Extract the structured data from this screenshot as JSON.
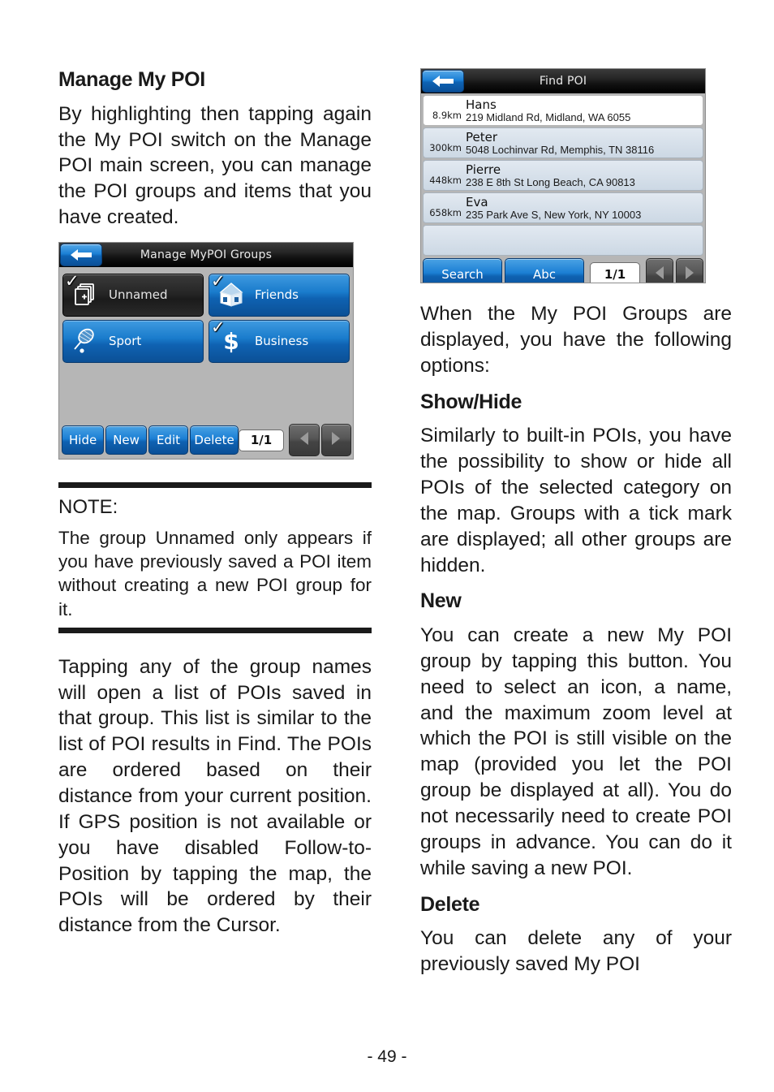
{
  "page": {
    "folio": "- 49 -"
  },
  "left": {
    "heading": "Manage My POI",
    "intro": "By highlighting then tapping again the My POI switch on the Manage POI main screen, you can manage the POI groups and items that you have created.",
    "note": {
      "label": "NOTE:",
      "text": "The group Unnamed only appears if you have previously saved a POI item without creating a new POI group for it."
    },
    "after_note": "Tapping any of the group names will open a list of POIs saved in that group. This list is similar to the list of POI results in Find. The POIs are ordered based on their distance from your current position. If GPS position is not available or you have disabled Follow-to-Position by tapping the map, the POIs will be ordered by their distance from the Cursor."
  },
  "right": {
    "intro": "When the My POI Groups are displayed, you have the following options:",
    "sections": [
      {
        "heading": "Show/Hide",
        "text": "Similarly to built-in POIs, you have the possibility to show or hide all POIs of the selected category on the map. Groups with a tick mark are displayed; all other groups are hidden."
      },
      {
        "heading": "New",
        "text": "You can create a new My POI group by tapping this button. You need to select an icon, a name, and the maximum zoom level at which the POI is still visible on the map (provided you let the POI group be displayed at all). You do not necessarily need to create POI groups in advance. You can do it while saving a new POI."
      },
      {
        "heading": "Delete",
        "text": "You can delete any of your previously saved My POI"
      }
    ]
  },
  "manage_groups_screen": {
    "title": "Manage MyPOI Groups",
    "back_icon": "back-arrow-icon",
    "tiles": [
      {
        "label": "Unnamed",
        "icon": "stacked-pages-plus-icon",
        "checked": true,
        "state": "dark"
      },
      {
        "label": "Friends",
        "icon": "house-icon",
        "checked": true,
        "state": "blue"
      },
      {
        "label": "Sport",
        "icon": "tennis-racket-icon",
        "checked": false,
        "state": "blue"
      },
      {
        "label": "Business",
        "icon": "dollar-sign-icon",
        "checked": true,
        "state": "blue"
      }
    ],
    "toolbar": {
      "buttons": [
        "Hide",
        "New",
        "Edit",
        "Delete"
      ],
      "page_indicator": "1/1",
      "prev_icon": "left-triangle-icon",
      "next_icon": "right-triangle-icon"
    },
    "colors": {
      "accent_blue": "#1b7fd4",
      "panel_gray": "#b6b6b6",
      "titlebar_black": "#111111"
    }
  },
  "find_poi_screen": {
    "title": "Find POI",
    "back_icon": "back-arrow-icon",
    "results": [
      {
        "distance": "8.9km",
        "name": "Hans",
        "address": "219 Midland Rd, Midland, WA 6055",
        "selected": true
      },
      {
        "distance": "300km",
        "name": "Peter",
        "address": "5048 Lochinvar Rd, Memphis, TN 38116",
        "selected": false
      },
      {
        "distance": "448km",
        "name": "Pierre",
        "address": "238 E 8th St Long Beach, CA 90813",
        "selected": false
      },
      {
        "distance": "658km",
        "name": "Eva",
        "address": "235 Park Ave S, New York, NY 10003",
        "selected": false
      }
    ],
    "toolbar": {
      "search_label": "Search",
      "abc_label": "Abc",
      "page_indicator": "1/1",
      "prev_icon": "left-triangle-icon",
      "next_icon": "right-triangle-icon"
    },
    "colors": {
      "accent_blue": "#1b7fd4",
      "row_blue_gray": "#d4dee8",
      "row_selected": "#ffffff"
    }
  }
}
